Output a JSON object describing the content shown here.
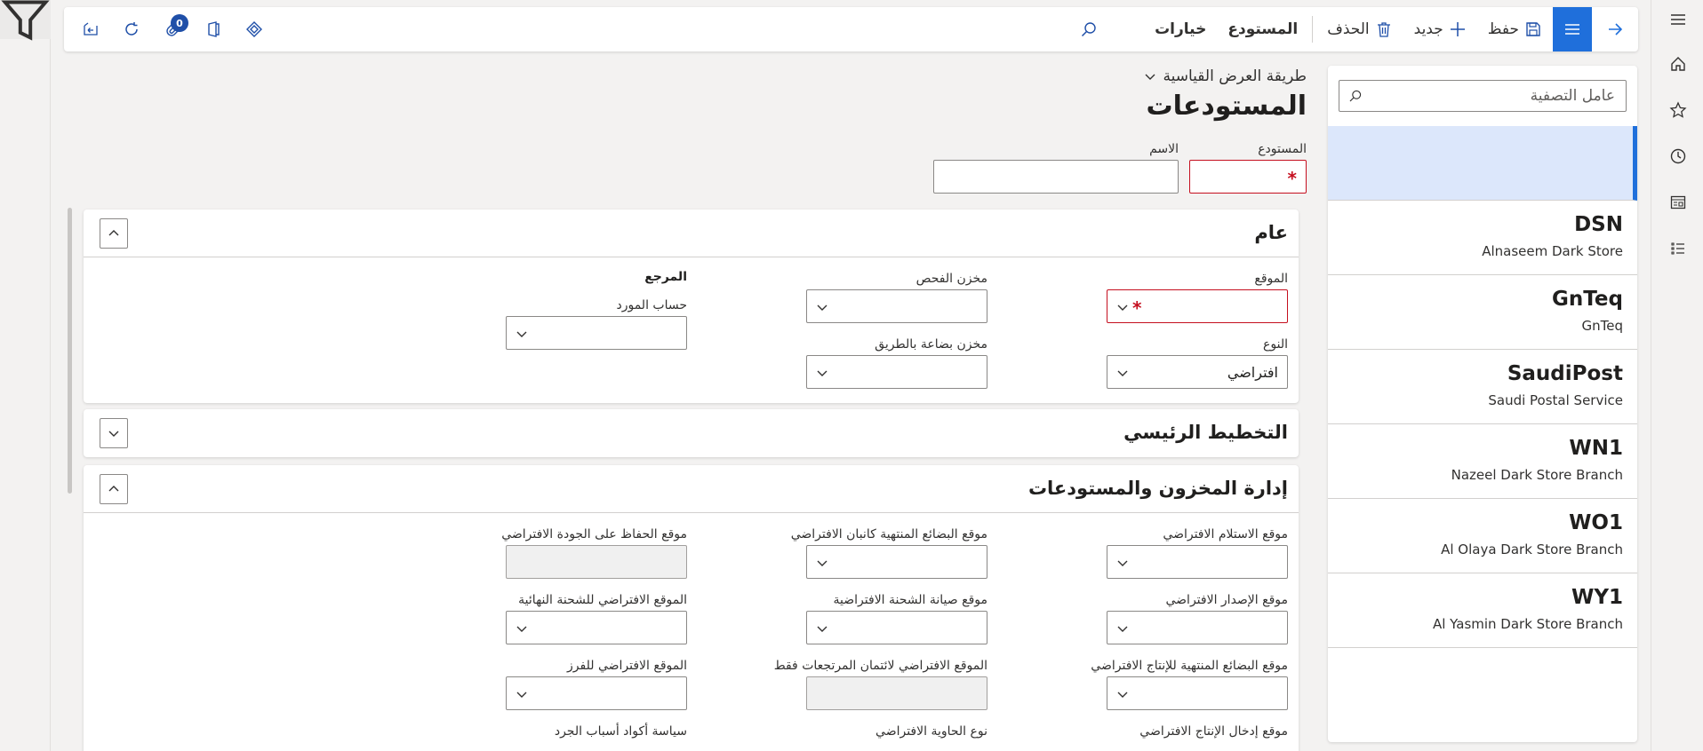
{
  "actionbar": {
    "save": "حفظ",
    "new": "جديد",
    "delete": "الحذف",
    "warehouse_tab": "المستودع",
    "options_tab": "خيارات",
    "attachments_count": "0"
  },
  "list": {
    "filter_placeholder": "عامل التصفية",
    "items": [
      {
        "code": "",
        "desc": ""
      },
      {
        "code": "DSN",
        "desc": "Alnaseem Dark Store"
      },
      {
        "code": "GnTeq",
        "desc": "GnTeq"
      },
      {
        "code": "SaudiPost",
        "desc": "Saudi Postal Service"
      },
      {
        "code": "WN1",
        "desc": "Nazeel Dark Store Branch"
      },
      {
        "code": "WO1",
        "desc": "Al Olaya Dark Store Branch"
      },
      {
        "code": "WY1",
        "desc": "Al Yasmin Dark Store Branch"
      }
    ]
  },
  "header": {
    "view_selector": "طريقة العرض القياسية",
    "title": "المستودعات",
    "warehouse_label": "المستودع",
    "name_label": "الاسم"
  },
  "general": {
    "title": "عام",
    "site_label": "الموقع",
    "type_label": "النوع",
    "type_value": "افتراضي",
    "inspection_label": "مخزن الفحص",
    "transit_label": "مخزن بضاعة بالطريق",
    "reference_group": "المرجع",
    "vendor_account_label": "حساب المورد"
  },
  "master_planning": {
    "title": "التخطيط الرئيسي"
  },
  "inventory": {
    "title": "إدارة المخزون والمستودعات",
    "receipt_loc": "موقع الاستلام الافتراضي",
    "issue_loc": "موقع الإصدار الافتراضي",
    "prod_finished_loc": "موقع البضائع المنتهية للإنتاج الافتراضي",
    "prod_input_loc": "موقع إدخال الإنتاج الافتراضي",
    "kanban_finished_loc": "موقع البضائع المنتهية كانبان الافتراضي",
    "ship_maint_loc": "موقع صيانة الشحنة الافتراضية",
    "returns_credit_loc": "الموقع الافتراضي لائتمان المرتجعات فقط",
    "container_type": "نوع الحاوية الافتراضي",
    "quality_hold_loc": "موقع الحفاظ على الجودة الافتراضي",
    "final_ship_loc": "الموقع الافتراضي للشحنة النهائية",
    "sort_loc": "الموقع الافتراضي للفرز",
    "count_reason_policy": "سياسة أكواد أسباب الجرد"
  }
}
